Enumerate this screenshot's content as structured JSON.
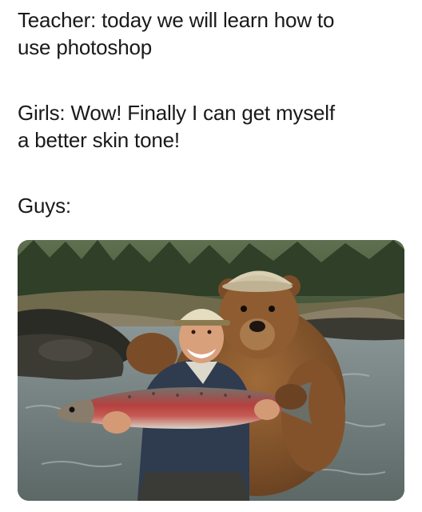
{
  "captions": {
    "teacher": "Teacher: today we will learn how to\nuse photoshop",
    "girls": "Girls: Wow! Finally I can get myself\na better skin tone!",
    "guys": "Guys:"
  },
  "photo": {
    "subject": "man in a cap holding a large red-striped trout while a brown bear wearing a cap hugs him from behind, in a river",
    "colors": {
      "forest": "#3f5233",
      "water": "#7c8a8c",
      "bear": "#8a5a30",
      "fish_red": "#b23a3a",
      "jacket": "#2f3b4f"
    }
  }
}
